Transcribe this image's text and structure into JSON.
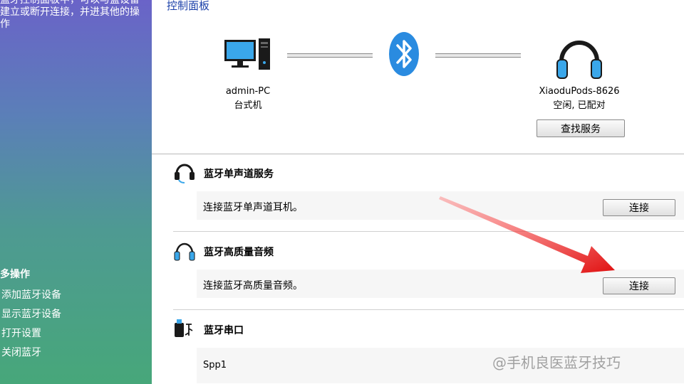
{
  "sidebar": {
    "intro": "蓝牙控制面板中，可以与蓝设备建立或断开连接，并进其他的操作",
    "more_title": "多操作",
    "menu": [
      "添加蓝牙设备",
      "显示蓝牙设备",
      "打开设置",
      "关闭蓝牙"
    ]
  },
  "header": {
    "breadcrumb": "控制面板"
  },
  "local_device": {
    "name": "admin-PC",
    "type": "台式机"
  },
  "remote_device": {
    "name": "XiaoduPods-8626",
    "status": "空闲, 已配对",
    "find_services_label": "查找服务"
  },
  "services": [
    {
      "icon": "headset-icon",
      "title": "蓝牙单声道服务",
      "description": "连接蓝牙单声道耳机。",
      "button": "连接"
    },
    {
      "icon": "headphones-icon",
      "title": "蓝牙高质量音频",
      "description": "连接蓝牙高质量音频。",
      "button": "连接"
    },
    {
      "icon": "serial-port-icon",
      "title": "蓝牙串口",
      "description": "Spp1"
    }
  ],
  "watermark": "@手机良医蓝牙技巧",
  "colors": {
    "bluetooth": "#2a8be0",
    "link": "#1a3fa8",
    "arrow": "#e01010"
  }
}
